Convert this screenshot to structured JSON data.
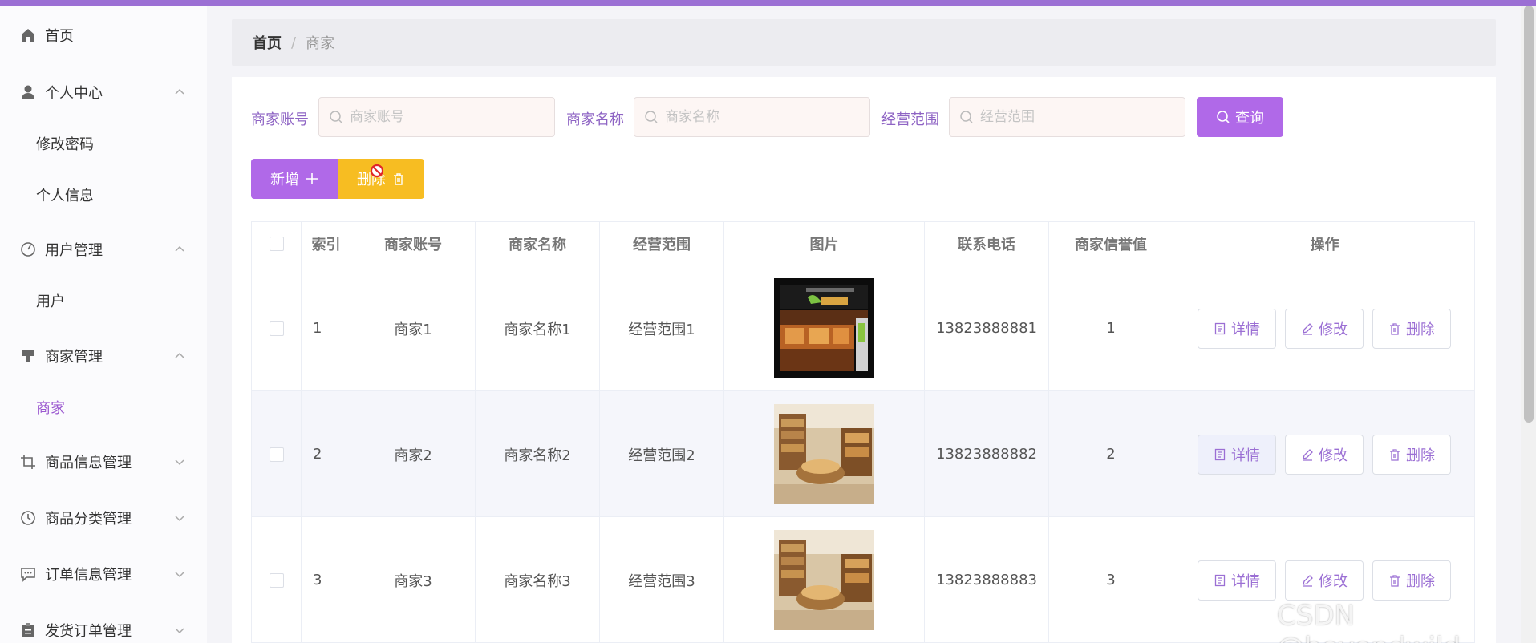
{
  "sidebar": {
    "items": [
      {
        "label": "首页"
      },
      {
        "label": "个人中心"
      },
      {
        "label": "修改密码"
      },
      {
        "label": "个人信息"
      },
      {
        "label": "用户管理"
      },
      {
        "label": "用户"
      },
      {
        "label": "商家管理"
      },
      {
        "label": "商家"
      },
      {
        "label": "商品信息管理"
      },
      {
        "label": "商品分类管理"
      },
      {
        "label": "订单信息管理"
      },
      {
        "label": "发货订单管理"
      }
    ]
  },
  "breadcrumb": {
    "home": "首页",
    "separator": "/",
    "current": "商家"
  },
  "search": {
    "account_label": "商家账号",
    "account_placeholder": "商家账号",
    "name_label": "商家名称",
    "name_placeholder": "商家名称",
    "scope_label": "经营范围",
    "scope_placeholder": "经营范围",
    "query_label": "查询"
  },
  "toolbar": {
    "add_label": "新增",
    "delete_label": "删除"
  },
  "table": {
    "headers": [
      "索引",
      "商家账号",
      "商家名称",
      "经营范围",
      "图片",
      "联系电话",
      "商家信誉值",
      "操作"
    ],
    "rows": [
      {
        "index": "1",
        "account": "商家1",
        "name": "商家名称1",
        "scope": "经营范围1",
        "phone": "13823888881",
        "credit": "1"
      },
      {
        "index": "2",
        "account": "商家2",
        "name": "商家名称2",
        "scope": "经营范围2",
        "phone": "13823888882",
        "credit": "2"
      },
      {
        "index": "3",
        "account": "商家3",
        "name": "商家名称3",
        "scope": "经营范围3",
        "phone": "13823888883",
        "credit": "3"
      }
    ],
    "actions": {
      "detail": "详情",
      "edit": "修改",
      "delete": "删除"
    }
  },
  "watermark": "CSDN @beyondwild",
  "colors": {
    "accent": "#b069e8",
    "warning": "#f7bd22",
    "topbar": "#9b6fd4"
  }
}
